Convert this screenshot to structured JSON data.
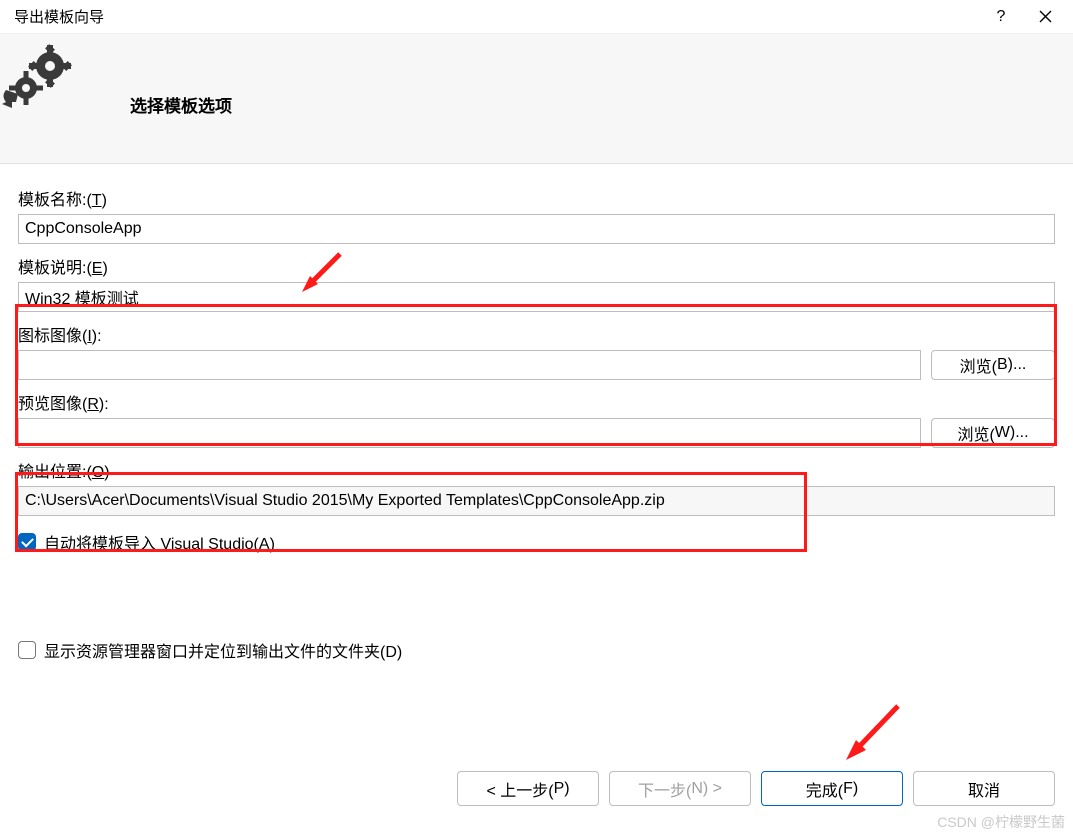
{
  "window": {
    "title": "导出模板向导"
  },
  "header": {
    "page_title": "选择模板选项"
  },
  "fields": {
    "template_name": {
      "label": "模板名称:(",
      "mnemonic": "T",
      "label_suffix": ")",
      "value": "CppConsoleApp"
    },
    "template_desc": {
      "label": "模板说明:(",
      "mnemonic": "E",
      "label_suffix": ")",
      "value": "Win32 模板测试"
    },
    "icon_image": {
      "label": "图标图像(",
      "mnemonic": "I",
      "label_suffix": "):",
      "value": "",
      "browse": "浏览(",
      "browse_mn": "B",
      "browse_suffix": ")..."
    },
    "preview_image": {
      "label": "预览图像(",
      "mnemonic": "R",
      "label_suffix": "):",
      "value": "",
      "browse": "浏览(",
      "browse_mn": "W",
      "browse_suffix": ")..."
    },
    "output_loc": {
      "label": "输出位置:(",
      "mnemonic": "O",
      "label_suffix": ")",
      "value": "C:\\Users\\Acer\\Documents\\Visual Studio 2015\\My Exported Templates\\CppConsoleApp.zip"
    }
  },
  "checks": {
    "auto_import": {
      "label_pre": "自动将模板导入 Visual Studio(",
      "mnemonic": "A",
      "label_suf": ")",
      "checked": true
    },
    "show_explorer": {
      "label_pre": "显示资源管理器窗口并定位到输出文件的文件夹(",
      "mnemonic": "D",
      "label_suf": ")",
      "checked": false
    }
  },
  "buttons": {
    "prev": {
      "pre": "< 上一步(",
      "mn": "P",
      "suf": ")"
    },
    "next": {
      "pre": "下一步(",
      "mn": "N",
      "suf": ") >"
    },
    "finish": {
      "pre": "完成(",
      "mn": "F",
      "suf": ")"
    },
    "cancel": {
      "label": "取消"
    }
  },
  "watermark": "CSDN @柠檬野生菌"
}
